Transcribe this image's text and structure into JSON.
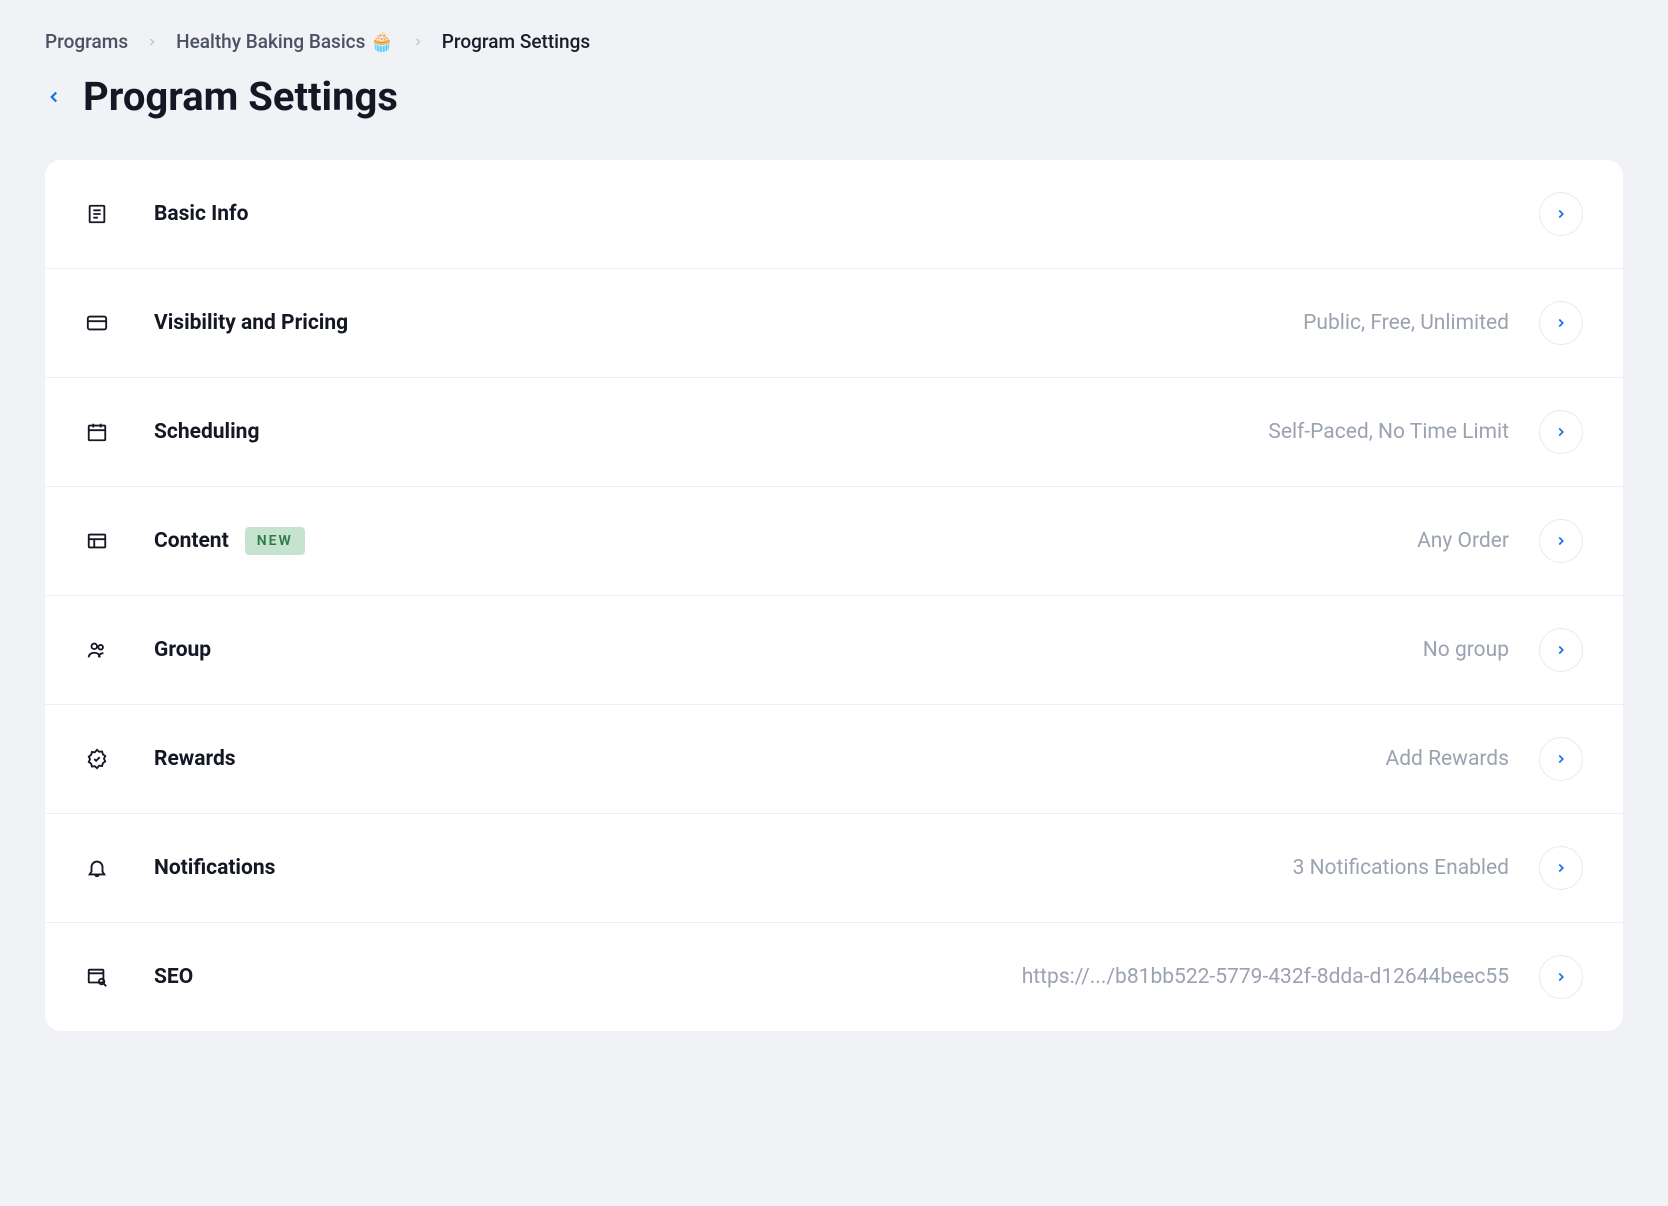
{
  "breadcrumb": {
    "items": [
      {
        "label": "Programs"
      },
      {
        "label": "Healthy Baking Basics 🧁"
      },
      {
        "label": "Program Settings"
      }
    ]
  },
  "page": {
    "title": "Program Settings"
  },
  "settings": {
    "rows": [
      {
        "label": "Basic Info",
        "value": "",
        "badge": ""
      },
      {
        "label": "Visibility and Pricing",
        "value": "Public, Free, Unlimited",
        "badge": ""
      },
      {
        "label": "Scheduling",
        "value": "Self-Paced, No Time Limit",
        "badge": ""
      },
      {
        "label": "Content",
        "value": "Any Order",
        "badge": "NEW"
      },
      {
        "label": "Group",
        "value": "No group",
        "badge": ""
      },
      {
        "label": "Rewards",
        "value": "Add Rewards",
        "badge": ""
      },
      {
        "label": "Notifications",
        "value": "3 Notifications Enabled",
        "badge": ""
      },
      {
        "label": "SEO",
        "value": "https://.../b81bb522-5779-432f-8dda-d12644beec55",
        "badge": ""
      }
    ]
  }
}
